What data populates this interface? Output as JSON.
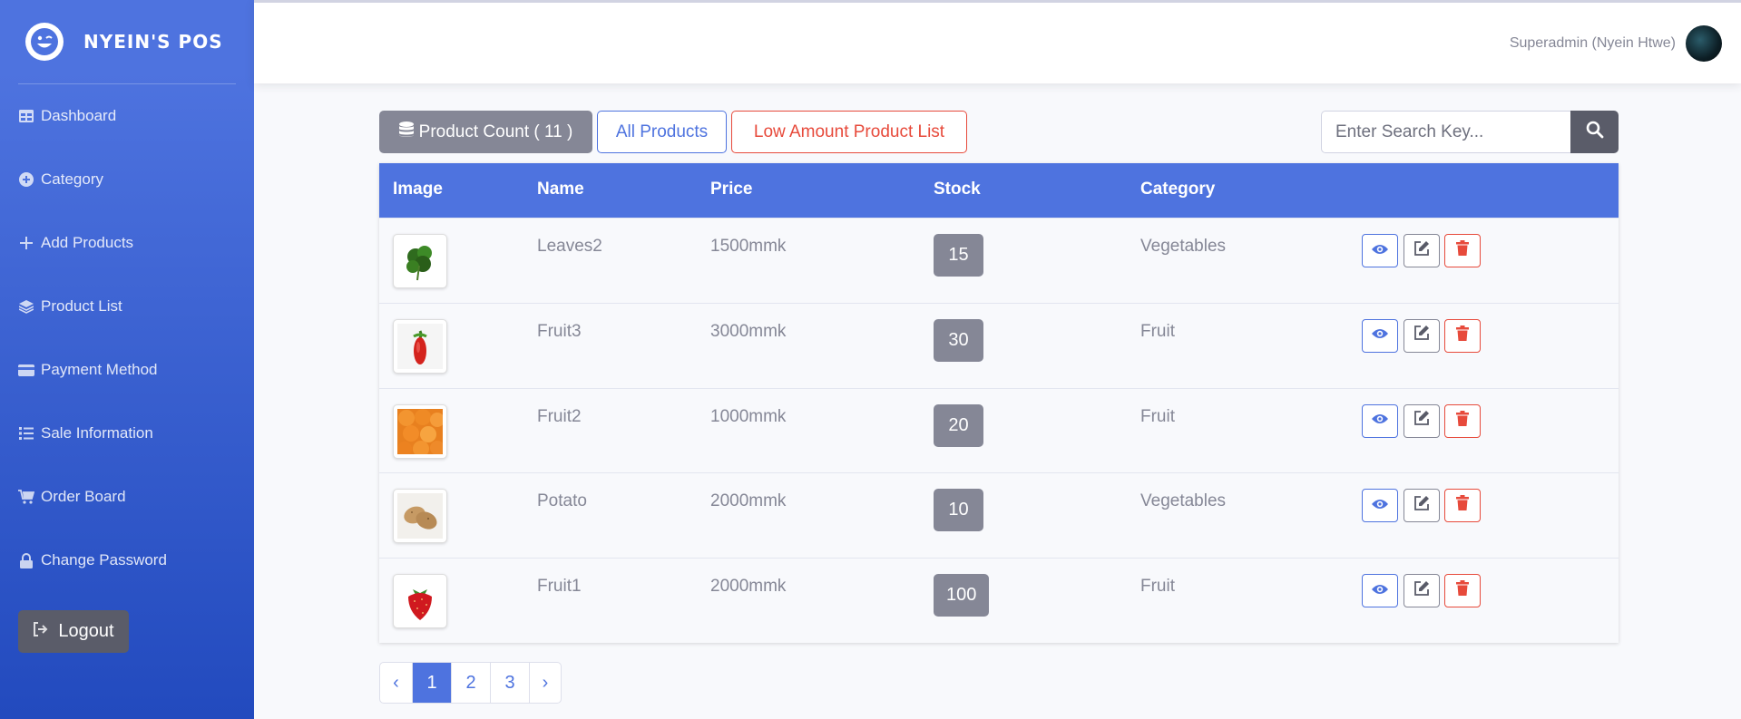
{
  "sidebar": {
    "brand": "NYEIN'S POS",
    "items": [
      {
        "label": "Dashboard",
        "icon": "table-icon"
      },
      {
        "label": "Category",
        "icon": "plus-circle-icon"
      },
      {
        "label": "Add Products",
        "icon": "plus-icon"
      },
      {
        "label": "Product List",
        "icon": "layers-icon"
      },
      {
        "label": "Payment Method",
        "icon": "credit-card-icon"
      },
      {
        "label": "Sale Information",
        "icon": "list-icon"
      },
      {
        "label": "Order Board",
        "icon": "cart-icon"
      },
      {
        "label": "Change Password",
        "icon": "lock-icon"
      }
    ],
    "logout_label": "Logout"
  },
  "topbar": {
    "user_name": "Superadmin (Nyein Htwe)"
  },
  "toolbar": {
    "count_label": "Product Count ( 11 )",
    "all_label": "All Products",
    "low_label": "Low Amount Product List",
    "search_placeholder": "Enter Search Key..."
  },
  "table": {
    "headers": [
      "Image",
      "Name",
      "Price",
      "Stock",
      "Category"
    ],
    "rows": [
      {
        "image": "leaves-image",
        "name": "Leaves2",
        "price": "1500mmk",
        "stock": "15",
        "category": "Vegetables"
      },
      {
        "image": "chili-image",
        "name": "Fruit3",
        "price": "3000mmk",
        "stock": "30",
        "category": "Fruit"
      },
      {
        "image": "apricot-image",
        "name": "Fruit2",
        "price": "1000mmk",
        "stock": "20",
        "category": "Fruit"
      },
      {
        "image": "potato-image",
        "name": "Potato",
        "price": "2000mmk",
        "stock": "10",
        "category": "Vegetables"
      },
      {
        "image": "strawberry-image",
        "name": "Fruit1",
        "price": "2000mmk",
        "stock": "100",
        "category": "Fruit"
      }
    ]
  },
  "pagination": {
    "prev": "‹",
    "pages": [
      "1",
      "2",
      "3"
    ],
    "active_page": "1",
    "next": "›"
  },
  "colors": {
    "primary": "#4e73df",
    "secondary": "#858796",
    "danger": "#e74a3b",
    "dark": "#5a5c69"
  }
}
